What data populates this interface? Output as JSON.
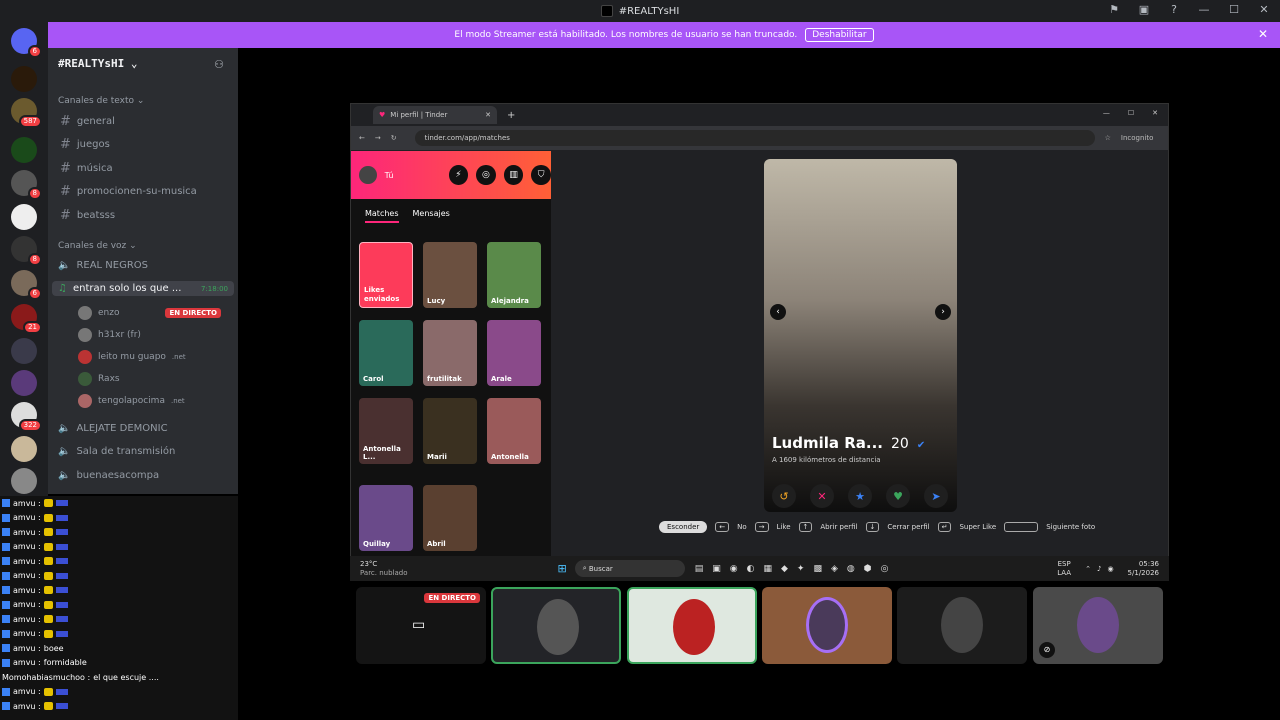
{
  "window": {
    "title": "#REALTYsHI"
  },
  "banner": {
    "text": "El modo Streamer está habilitado. Los nombres de usuario se han truncado.",
    "button": "Deshabilitar"
  },
  "rail": {
    "badges": [
      "6",
      "587",
      "8",
      "8",
      "6",
      "21",
      "322"
    ]
  },
  "sidebar": {
    "server_name": "#REALTYsHI",
    "text_category": "Canales de texto",
    "text_channels": [
      "general",
      "juegos",
      "música",
      "promocionen-su-musica",
      "beatsss"
    ],
    "voice_category": "Canales de voz",
    "voice_channels": {
      "real": "REAL NEGROS",
      "active": "entran solo los que ...",
      "active_time": "7:18:00",
      "others": [
        "ALEJATE DEMONIC",
        "Sala de transmisión",
        "buenaesacompa"
      ]
    },
    "voice_users": [
      {
        "name": "enzo",
        "live": "EN DIRECTO"
      },
      {
        "name": "h31xr (fr)"
      },
      {
        "name": "leito mu guapo",
        "tag": ".net"
      },
      {
        "name": "Raxs"
      },
      {
        "name": "tengolapocima",
        "tag": ".net"
      }
    ]
  },
  "chatlog": {
    "user": "amvu :",
    "lines": [
      "boee",
      "formidable"
    ],
    "other_user": "Momohabiasmuchoo :",
    "other_text": "el que escuje ...."
  },
  "browser": {
    "tab_title": "Mi perfil | Tinder",
    "url": "tinder.com/app/matches",
    "incognito": "Incognito"
  },
  "tinder": {
    "profile_label": "Tú",
    "tabs": [
      "Matches",
      "Mensajes"
    ],
    "likes_label": "Likes enviados",
    "matches": [
      "Lucy",
      "Alejandra",
      "Carol",
      "frutilitak",
      "Arale",
      "Antonella L...",
      "Marii",
      "Antonella",
      "Quillay",
      "Abril"
    ],
    "card": {
      "name": "Ludmila Ra...",
      "age": "20",
      "distance": "A 1609 kilómetros de distancia"
    },
    "shortcuts": {
      "hide": "Esconder",
      "no": "No",
      "like": "Like",
      "open": "Abrir perfil",
      "close": "Cerrar perfil",
      "super": "Super Like",
      "next": "Siguiente foto"
    }
  },
  "taskbar": {
    "temp": "23°C",
    "weather": "Parc. nublado",
    "search": "Buscar",
    "lang": "ESP",
    "lang2": "LAA",
    "time": "05:36",
    "date": "5/1/2026"
  },
  "video": {
    "live": "EN DIRECTO"
  }
}
